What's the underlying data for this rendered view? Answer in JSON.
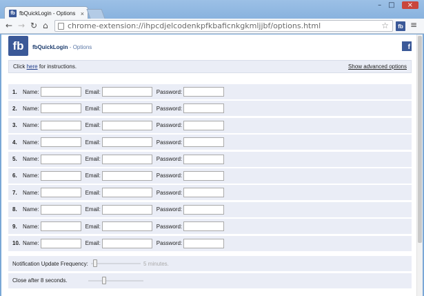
{
  "browser": {
    "tab_title": "fbQuickLogin - Options",
    "tab_favicon": "fb",
    "url": "chrome-extension://ihpcdjelcodenkpfkbaficnkgkmljjbf/options.html",
    "ext_badge": "fb"
  },
  "header": {
    "logo": "fb",
    "app_name": "fbQuickLogin",
    "separator": "-",
    "subtitle": "Options",
    "corner_icon": "f"
  },
  "instructions": {
    "prefix": "Click",
    "link": "here",
    "suffix": "for instructions.",
    "advanced": "Show advanced options"
  },
  "labels": {
    "name": "Name:",
    "email": "Email:",
    "password": "Password:"
  },
  "accounts": [
    {
      "number": "1.",
      "name": "",
      "email": "",
      "password": ""
    },
    {
      "number": "2.",
      "name": "",
      "email": "",
      "password": ""
    },
    {
      "number": "3.",
      "name": "",
      "email": "",
      "password": ""
    },
    {
      "number": "4.",
      "name": "",
      "email": "",
      "password": ""
    },
    {
      "number": "5.",
      "name": "",
      "email": "",
      "password": ""
    },
    {
      "number": "6.",
      "name": "",
      "email": "",
      "password": ""
    },
    {
      "number": "7.",
      "name": "",
      "email": "",
      "password": ""
    },
    {
      "number": "8.",
      "name": "",
      "email": "",
      "password": ""
    },
    {
      "number": "9.",
      "name": "",
      "email": "",
      "password": ""
    },
    {
      "number": "10.",
      "name": "",
      "email": "",
      "password": ""
    }
  ],
  "settings": {
    "notification_label": "Notification Update Frequency:",
    "notification_value": "5 minutes.",
    "notification_level": 0,
    "close_label": "Close after 8 seconds.",
    "close_level": 0.27
  },
  "colors": {
    "facebook_blue": "#3b5998",
    "row_bg": "#eaedf6"
  }
}
